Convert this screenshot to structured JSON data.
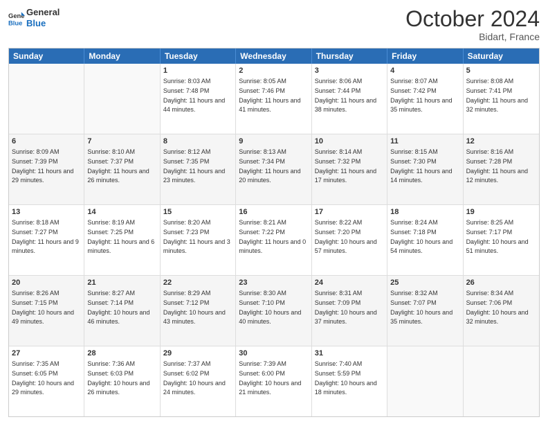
{
  "header": {
    "logo_line1": "General",
    "logo_line2": "Blue",
    "month": "October 2024",
    "location": "Bidart, France"
  },
  "days_of_week": [
    "Sunday",
    "Monday",
    "Tuesday",
    "Wednesday",
    "Thursday",
    "Friday",
    "Saturday"
  ],
  "weeks": [
    [
      {
        "day": "",
        "sunrise": "",
        "sunset": "",
        "daylight": ""
      },
      {
        "day": "",
        "sunrise": "",
        "sunset": "",
        "daylight": ""
      },
      {
        "day": "1",
        "sunrise": "Sunrise: 8:03 AM",
        "sunset": "Sunset: 7:48 PM",
        "daylight": "Daylight: 11 hours and 44 minutes."
      },
      {
        "day": "2",
        "sunrise": "Sunrise: 8:05 AM",
        "sunset": "Sunset: 7:46 PM",
        "daylight": "Daylight: 11 hours and 41 minutes."
      },
      {
        "day": "3",
        "sunrise": "Sunrise: 8:06 AM",
        "sunset": "Sunset: 7:44 PM",
        "daylight": "Daylight: 11 hours and 38 minutes."
      },
      {
        "day": "4",
        "sunrise": "Sunrise: 8:07 AM",
        "sunset": "Sunset: 7:42 PM",
        "daylight": "Daylight: 11 hours and 35 minutes."
      },
      {
        "day": "5",
        "sunrise": "Sunrise: 8:08 AM",
        "sunset": "Sunset: 7:41 PM",
        "daylight": "Daylight: 11 hours and 32 minutes."
      }
    ],
    [
      {
        "day": "6",
        "sunrise": "Sunrise: 8:09 AM",
        "sunset": "Sunset: 7:39 PM",
        "daylight": "Daylight: 11 hours and 29 minutes."
      },
      {
        "day": "7",
        "sunrise": "Sunrise: 8:10 AM",
        "sunset": "Sunset: 7:37 PM",
        "daylight": "Daylight: 11 hours and 26 minutes."
      },
      {
        "day": "8",
        "sunrise": "Sunrise: 8:12 AM",
        "sunset": "Sunset: 7:35 PM",
        "daylight": "Daylight: 11 hours and 23 minutes."
      },
      {
        "day": "9",
        "sunrise": "Sunrise: 8:13 AM",
        "sunset": "Sunset: 7:34 PM",
        "daylight": "Daylight: 11 hours and 20 minutes."
      },
      {
        "day": "10",
        "sunrise": "Sunrise: 8:14 AM",
        "sunset": "Sunset: 7:32 PM",
        "daylight": "Daylight: 11 hours and 17 minutes."
      },
      {
        "day": "11",
        "sunrise": "Sunrise: 8:15 AM",
        "sunset": "Sunset: 7:30 PM",
        "daylight": "Daylight: 11 hours and 14 minutes."
      },
      {
        "day": "12",
        "sunrise": "Sunrise: 8:16 AM",
        "sunset": "Sunset: 7:28 PM",
        "daylight": "Daylight: 11 hours and 12 minutes."
      }
    ],
    [
      {
        "day": "13",
        "sunrise": "Sunrise: 8:18 AM",
        "sunset": "Sunset: 7:27 PM",
        "daylight": "Daylight: 11 hours and 9 minutes."
      },
      {
        "day": "14",
        "sunrise": "Sunrise: 8:19 AM",
        "sunset": "Sunset: 7:25 PM",
        "daylight": "Daylight: 11 hours and 6 minutes."
      },
      {
        "day": "15",
        "sunrise": "Sunrise: 8:20 AM",
        "sunset": "Sunset: 7:23 PM",
        "daylight": "Daylight: 11 hours and 3 minutes."
      },
      {
        "day": "16",
        "sunrise": "Sunrise: 8:21 AM",
        "sunset": "Sunset: 7:22 PM",
        "daylight": "Daylight: 11 hours and 0 minutes."
      },
      {
        "day": "17",
        "sunrise": "Sunrise: 8:22 AM",
        "sunset": "Sunset: 7:20 PM",
        "daylight": "Daylight: 10 hours and 57 minutes."
      },
      {
        "day": "18",
        "sunrise": "Sunrise: 8:24 AM",
        "sunset": "Sunset: 7:18 PM",
        "daylight": "Daylight: 10 hours and 54 minutes."
      },
      {
        "day": "19",
        "sunrise": "Sunrise: 8:25 AM",
        "sunset": "Sunset: 7:17 PM",
        "daylight": "Daylight: 10 hours and 51 minutes."
      }
    ],
    [
      {
        "day": "20",
        "sunrise": "Sunrise: 8:26 AM",
        "sunset": "Sunset: 7:15 PM",
        "daylight": "Daylight: 10 hours and 49 minutes."
      },
      {
        "day": "21",
        "sunrise": "Sunrise: 8:27 AM",
        "sunset": "Sunset: 7:14 PM",
        "daylight": "Daylight: 10 hours and 46 minutes."
      },
      {
        "day": "22",
        "sunrise": "Sunrise: 8:29 AM",
        "sunset": "Sunset: 7:12 PM",
        "daylight": "Daylight: 10 hours and 43 minutes."
      },
      {
        "day": "23",
        "sunrise": "Sunrise: 8:30 AM",
        "sunset": "Sunset: 7:10 PM",
        "daylight": "Daylight: 10 hours and 40 minutes."
      },
      {
        "day": "24",
        "sunrise": "Sunrise: 8:31 AM",
        "sunset": "Sunset: 7:09 PM",
        "daylight": "Daylight: 10 hours and 37 minutes."
      },
      {
        "day": "25",
        "sunrise": "Sunrise: 8:32 AM",
        "sunset": "Sunset: 7:07 PM",
        "daylight": "Daylight: 10 hours and 35 minutes."
      },
      {
        "day": "26",
        "sunrise": "Sunrise: 8:34 AM",
        "sunset": "Sunset: 7:06 PM",
        "daylight": "Daylight: 10 hours and 32 minutes."
      }
    ],
    [
      {
        "day": "27",
        "sunrise": "Sunrise: 7:35 AM",
        "sunset": "Sunset: 6:05 PM",
        "daylight": "Daylight: 10 hours and 29 minutes."
      },
      {
        "day": "28",
        "sunrise": "Sunrise: 7:36 AM",
        "sunset": "Sunset: 6:03 PM",
        "daylight": "Daylight: 10 hours and 26 minutes."
      },
      {
        "day": "29",
        "sunrise": "Sunrise: 7:37 AM",
        "sunset": "Sunset: 6:02 PM",
        "daylight": "Daylight: 10 hours and 24 minutes."
      },
      {
        "day": "30",
        "sunrise": "Sunrise: 7:39 AM",
        "sunset": "Sunset: 6:00 PM",
        "daylight": "Daylight: 10 hours and 21 minutes."
      },
      {
        "day": "31",
        "sunrise": "Sunrise: 7:40 AM",
        "sunset": "Sunset: 5:59 PM",
        "daylight": "Daylight: 10 hours and 18 minutes."
      },
      {
        "day": "",
        "sunrise": "",
        "sunset": "",
        "daylight": ""
      },
      {
        "day": "",
        "sunrise": "",
        "sunset": "",
        "daylight": ""
      }
    ]
  ]
}
